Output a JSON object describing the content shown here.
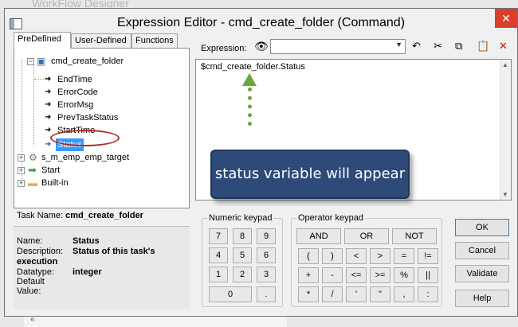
{
  "background": {
    "title": "WorkFlow Designer",
    "scroll_chevron": "«"
  },
  "dialog": {
    "title": "Expression Editor - cmd_create_folder (Command)",
    "close_label": "✕"
  },
  "tabs": [
    {
      "label": "PreDefined",
      "active": true
    },
    {
      "label": "User-Defined",
      "active": false
    },
    {
      "label": "Functions",
      "active": false
    }
  ],
  "tree": {
    "root": "cmd_create_folder",
    "children": [
      "EndTime",
      "ErrorCode",
      "ErrorMsg",
      "PrevTaskStatus",
      "StartTime",
      "Status"
    ],
    "selected": "Status",
    "siblings": [
      "s_m_emp_emp_target",
      "Start",
      "Built-in"
    ]
  },
  "task": {
    "label": "Task Name:",
    "value": "cmd_create_folder"
  },
  "info": {
    "name_key": "Name:",
    "name_val": "Status",
    "desc_key": "Description:",
    "desc_val": "Status of this task's",
    "desc_cont": "execution",
    "type_key": "Datatype:",
    "type_val": "integer",
    "default_key": "Default Value:",
    "default_val": ""
  },
  "expression": {
    "label": "Expression:",
    "combo_value": "",
    "text": "$cmd_create_folder.Status"
  },
  "toolbar_icons": [
    "undo-icon",
    "cut-icon",
    "copy-icon",
    "paste-icon",
    "delete-icon"
  ],
  "annotation": {
    "callout": "status variable will appear",
    "color": "#6aa639",
    "callout_bg": "#2e4a78"
  },
  "numeric_keypad": {
    "title": "Numeric keypad",
    "keys": [
      "7",
      "8",
      "9",
      "4",
      "5",
      "6",
      "1",
      "2",
      "3",
      "0",
      "."
    ]
  },
  "operator_keypad": {
    "title": "Operator keypad",
    "row1": [
      "AND",
      "OR",
      "NOT"
    ],
    "row2": [
      "(",
      ")",
      "<",
      ">",
      "=",
      "!="
    ],
    "row3": [
      "+",
      "-",
      "<=",
      ">=",
      "%",
      "||"
    ],
    "row4": [
      "*",
      "/",
      "'",
      "\"",
      ",",
      ":"
    ]
  },
  "buttons": {
    "ok": "OK",
    "cancel": "Cancel",
    "validate": "Validate",
    "help": "Help"
  }
}
